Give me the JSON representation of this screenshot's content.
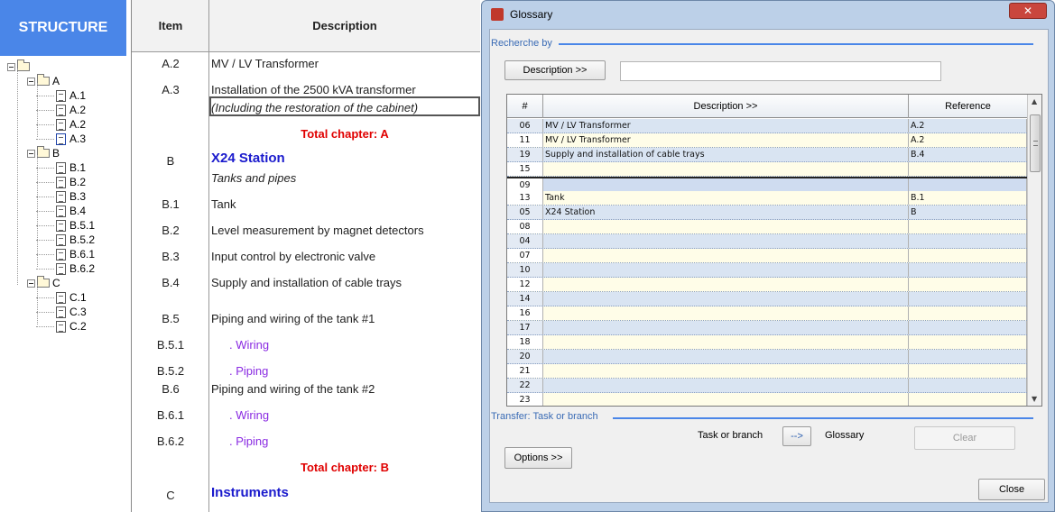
{
  "structure": {
    "title": "STRUCTURE",
    "tree": [
      {
        "label": "",
        "level": 0,
        "type": "folder"
      },
      {
        "label": "A",
        "level": 1,
        "type": "folder"
      },
      {
        "label": "A.1",
        "level": 2,
        "type": "doc"
      },
      {
        "label": "A.2",
        "level": 2,
        "type": "doc"
      },
      {
        "label": "A.2",
        "level": 2,
        "type": "doc"
      },
      {
        "label": "A.3",
        "level": 2,
        "type": "doc",
        "selected": true
      },
      {
        "label": "B",
        "level": 1,
        "type": "folder"
      },
      {
        "label": "B.1",
        "level": 2,
        "type": "doc"
      },
      {
        "label": "B.2",
        "level": 2,
        "type": "doc"
      },
      {
        "label": "B.3",
        "level": 2,
        "type": "doc"
      },
      {
        "label": "B.4",
        "level": 2,
        "type": "doc"
      },
      {
        "label": "B.5.1",
        "level": 2,
        "type": "doc"
      },
      {
        "label": "B.5.2",
        "level": 2,
        "type": "doc"
      },
      {
        "label": "B.6.1",
        "level": 2,
        "type": "doc"
      },
      {
        "label": "B.6.2",
        "level": 2,
        "type": "doc"
      },
      {
        "label": "C",
        "level": 1,
        "type": "folder"
      },
      {
        "label": "C.1",
        "level": 2,
        "type": "doc"
      },
      {
        "label": "C.3",
        "level": 2,
        "type": "doc"
      },
      {
        "label": "C.2",
        "level": 2,
        "type": "doc"
      }
    ]
  },
  "table": {
    "header_item": "Item",
    "header_description": "Description",
    "rows": [
      {
        "item": "A.2",
        "description": "MV / LV Transformer",
        "style": "normal"
      },
      {
        "item": "A.3",
        "description": "Installation of the 2500 kVA transformer",
        "style": "normal"
      },
      {
        "item": "",
        "description": "(Including the restoration of the cabinet)",
        "style": "italic"
      },
      {
        "item": "",
        "description": "Total chapter: A",
        "style": "total"
      },
      {
        "item": "B",
        "description": "X24 Station",
        "style": "section"
      },
      {
        "item": "",
        "description": "Tanks and pipes",
        "style": "italic"
      },
      {
        "item": "B.1",
        "description": "Tank",
        "style": "normal"
      },
      {
        "item": "B.2",
        "description": "Level measurement by magnet detectors",
        "style": "normal"
      },
      {
        "item": "B.3",
        "description": "Input control by electronic valve",
        "style": "normal"
      },
      {
        "item": "B.4",
        "description": "Supply and installation of cable trays",
        "style": "normal"
      },
      {
        "item": "B.5",
        "description": "Piping and wiring of the tank #1",
        "style": "normal"
      },
      {
        "item": "B.5.1",
        "description": ". Wiring",
        "style": "sub"
      },
      {
        "item": "B.5.2",
        "description": ". Piping",
        "style": "sub"
      },
      {
        "item": "B.6",
        "description": "Piping and wiring of the tank #2",
        "style": "normal"
      },
      {
        "item": "B.6.1",
        "description": ". Wiring",
        "style": "sub"
      },
      {
        "item": "B.6.2",
        "description": ". Piping",
        "style": "sub"
      },
      {
        "item": "",
        "description": "Total chapter: B",
        "style": "total"
      },
      {
        "item": "C",
        "description": "Instruments",
        "style": "section"
      }
    ]
  },
  "glossary": {
    "title": "Glossary",
    "close_x": "✕",
    "search_group": "Recherche by",
    "search_button": "Description >>",
    "search_value": "",
    "columns": {
      "num": "#",
      "description": "Description >>",
      "reference": "Reference"
    },
    "rows": [
      {
        "num": "06",
        "description": "MV / LV Transformer",
        "reference": "A.2"
      },
      {
        "num": "11",
        "description": "MV / LV Transformer",
        "reference": "A.2"
      },
      {
        "num": "19",
        "description": "Supply and installation of cable trays",
        "reference": "B.4"
      },
      {
        "num": "15",
        "description": "",
        "reference": ""
      },
      {
        "num": "09",
        "description": "",
        "reference": "",
        "selected": true
      },
      {
        "num": "13",
        "description": "Tank",
        "reference": "B.1"
      },
      {
        "num": "05",
        "description": "X24 Station",
        "reference": "B"
      },
      {
        "num": "08",
        "description": "",
        "reference": ""
      },
      {
        "num": "04",
        "description": "",
        "reference": ""
      },
      {
        "num": "07",
        "description": "",
        "reference": ""
      },
      {
        "num": "10",
        "description": "",
        "reference": ""
      },
      {
        "num": "12",
        "description": "",
        "reference": ""
      },
      {
        "num": "14",
        "description": "",
        "reference": ""
      },
      {
        "num": "16",
        "description": "",
        "reference": ""
      },
      {
        "num": "17",
        "description": "",
        "reference": ""
      },
      {
        "num": "18",
        "description": "",
        "reference": ""
      },
      {
        "num": "20",
        "description": "",
        "reference": ""
      },
      {
        "num": "21",
        "description": "",
        "reference": ""
      },
      {
        "num": "22",
        "description": "",
        "reference": ""
      },
      {
        "num": "23",
        "description": "",
        "reference": ""
      }
    ],
    "transfer_group": "Transfer: Task or branch",
    "task_label": "Task or branch",
    "arrow_button": "-->",
    "glossary_label": "Glossary",
    "clear_button": "Clear",
    "options_button": "Options >>",
    "close_button": "Close"
  },
  "colors": {
    "structure_header": "#4a86e8",
    "total_red": "#e00000",
    "section_blue": "#1a1acd",
    "sub_purple": "#8a2be2"
  }
}
